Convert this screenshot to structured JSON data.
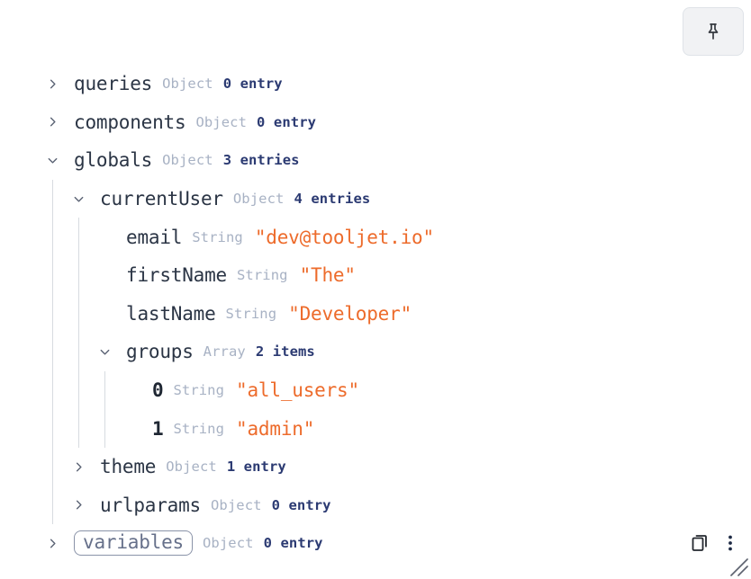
{
  "toolbar": {
    "pin_button_label": "Pin",
    "pin_icon": "pin-icon"
  },
  "bottom_tools": {
    "copy_label": "Copy",
    "copy_icon": "copy-icon",
    "menu_label": "More options",
    "menu_icon": "vertical-dots-icon",
    "resize_icon": "resize-grip-icon"
  },
  "colors": {
    "background": "#ffffff",
    "key_text": "#2b3545",
    "type_text": "#a8b2c4",
    "count_text": "#2b3a72",
    "string_value": "#ed6b2b",
    "rail": "#d7dbe0",
    "chevron": "#5b6374",
    "highlight_border": "#8a93a8",
    "pin_button_bg": "#f1f2f4"
  },
  "tree": {
    "rows": [
      {
        "key": "queries",
        "type": "Object",
        "count": "0 entry",
        "depth": 0,
        "expanded": false,
        "toggle": true,
        "highlighted": false
      },
      {
        "key": "components",
        "type": "Object",
        "count": "0 entry",
        "depth": 0,
        "expanded": false,
        "toggle": true,
        "highlighted": false
      },
      {
        "key": "globals",
        "type": "Object",
        "count": "3 entries",
        "depth": 0,
        "expanded": true,
        "toggle": true,
        "highlighted": false
      },
      {
        "key": "currentUser",
        "type": "Object",
        "count": "4 entries",
        "depth": 1,
        "expanded": true,
        "toggle": true,
        "highlighted": false
      },
      {
        "key": "email",
        "type": "String",
        "value": "\"dev@tooljet.io\"",
        "depth": 2,
        "toggle": false,
        "highlighted": false
      },
      {
        "key": "firstName",
        "type": "String",
        "value": "\"The\"",
        "depth": 2,
        "toggle": false,
        "highlighted": false
      },
      {
        "key": "lastName",
        "type": "String",
        "value": "\"Developer\"",
        "depth": 2,
        "toggle": false,
        "highlighted": false
      },
      {
        "key": "groups",
        "type": "Array",
        "count": "2 items",
        "depth": 2,
        "expanded": true,
        "toggle": true,
        "highlighted": false
      },
      {
        "key": "0",
        "type": "String",
        "value": "\"all_users\"",
        "depth": 3,
        "toggle": false,
        "index": true,
        "highlighted": false
      },
      {
        "key": "1",
        "type": "String",
        "value": "\"admin\"",
        "depth": 3,
        "toggle": false,
        "index": true,
        "highlighted": false
      },
      {
        "key": "theme",
        "type": "Object",
        "count": "1 entry",
        "depth": 1,
        "expanded": false,
        "toggle": true,
        "highlighted": false
      },
      {
        "key": "urlparams",
        "type": "Object",
        "count": "0 entry",
        "depth": 1,
        "expanded": false,
        "toggle": true,
        "highlighted": false
      },
      {
        "key": "variables",
        "type": "Object",
        "count": "0 entry",
        "depth": 0,
        "expanded": false,
        "toggle": true,
        "highlighted": true
      }
    ]
  }
}
